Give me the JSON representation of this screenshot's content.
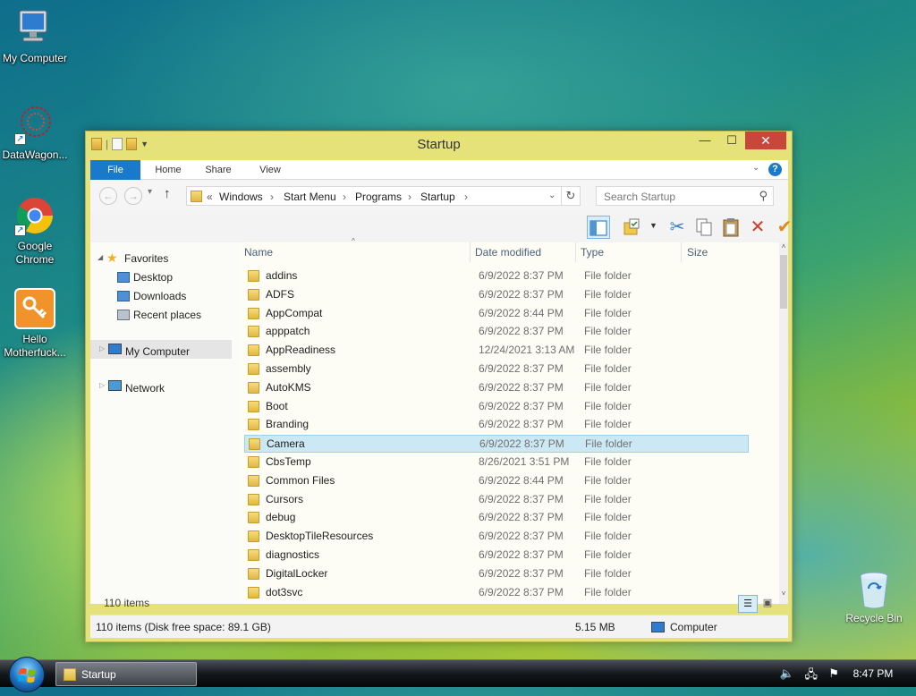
{
  "desktop": {
    "icons": [
      {
        "label": "My Computer"
      },
      {
        "label": "DataWagon..."
      },
      {
        "label": "Google Chrome"
      },
      {
        "label": "Hello Motherfuck..."
      }
    ],
    "recycle_bin": "Recycle Bin"
  },
  "window": {
    "title": "Startup",
    "controls": {
      "minimize": "—",
      "maximize": "☐",
      "close": "✕"
    },
    "ribbon_tabs": [
      "File",
      "Home",
      "Share",
      "View"
    ],
    "breadcrumb": {
      "overflow": "«",
      "parts": [
        "Windows",
        "Start Menu",
        "Programs",
        "Startup"
      ]
    },
    "search_placeholder": "Search Startup",
    "nav_pane": {
      "favorites": "Favorites",
      "favorites_items": [
        "Desktop",
        "Downloads",
        "Recent places"
      ],
      "my_computer": "My Computer",
      "network": "Network"
    },
    "columns": [
      "Name",
      "Date modified",
      "Type",
      "Size"
    ],
    "files": [
      {
        "name": "addins",
        "date": "6/9/2022 8:37 PM",
        "type": "File folder"
      },
      {
        "name": "ADFS",
        "date": "6/9/2022 8:37 PM",
        "type": "File folder"
      },
      {
        "name": "AppCompat",
        "date": "6/9/2022 8:44 PM",
        "type": "File folder"
      },
      {
        "name": "apppatch",
        "date": "6/9/2022 8:37 PM",
        "type": "File folder"
      },
      {
        "name": "AppReadiness",
        "date": "12/24/2021 3:13 AM",
        "type": "File folder"
      },
      {
        "name": "assembly",
        "date": "6/9/2022 8:37 PM",
        "type": "File folder"
      },
      {
        "name": "AutoKMS",
        "date": "6/9/2022 8:37 PM",
        "type": "File folder"
      },
      {
        "name": "Boot",
        "date": "6/9/2022 8:37 PM",
        "type": "File folder"
      },
      {
        "name": "Branding",
        "date": "6/9/2022 8:37 PM",
        "type": "File folder"
      },
      {
        "name": "Camera",
        "date": "6/9/2022 8:37 PM",
        "type": "File folder",
        "selected": true
      },
      {
        "name": "CbsTemp",
        "date": "8/26/2021 3:51 PM",
        "type": "File folder"
      },
      {
        "name": "Common Files",
        "date": "6/9/2022 8:44 PM",
        "type": "File folder"
      },
      {
        "name": "Cursors",
        "date": "6/9/2022 8:37 PM",
        "type": "File folder"
      },
      {
        "name": "debug",
        "date": "6/9/2022 8:37 PM",
        "type": "File folder"
      },
      {
        "name": "DesktopTileResources",
        "date": "6/9/2022 8:37 PM",
        "type": "File folder"
      },
      {
        "name": "diagnostics",
        "date": "6/9/2022 8:37 PM",
        "type": "File folder"
      },
      {
        "name": "DigitalLocker",
        "date": "6/9/2022 8:37 PM",
        "type": "File folder"
      },
      {
        "name": "dot3svc",
        "date": "6/9/2022 8:37 PM",
        "type": "File folder"
      }
    ],
    "item_count": "110 items",
    "status": {
      "items_disk": "110 items (Disk free space: 89.1 GB)",
      "size": "5.15 MB",
      "location": "Computer"
    }
  },
  "taskbar": {
    "task_label": "Startup",
    "clock": "8:47 PM"
  },
  "colors": {
    "accent": "#1979ca",
    "selection": "#cce8f4",
    "window_frame": "#e6e27a",
    "close": "#c9463d"
  }
}
